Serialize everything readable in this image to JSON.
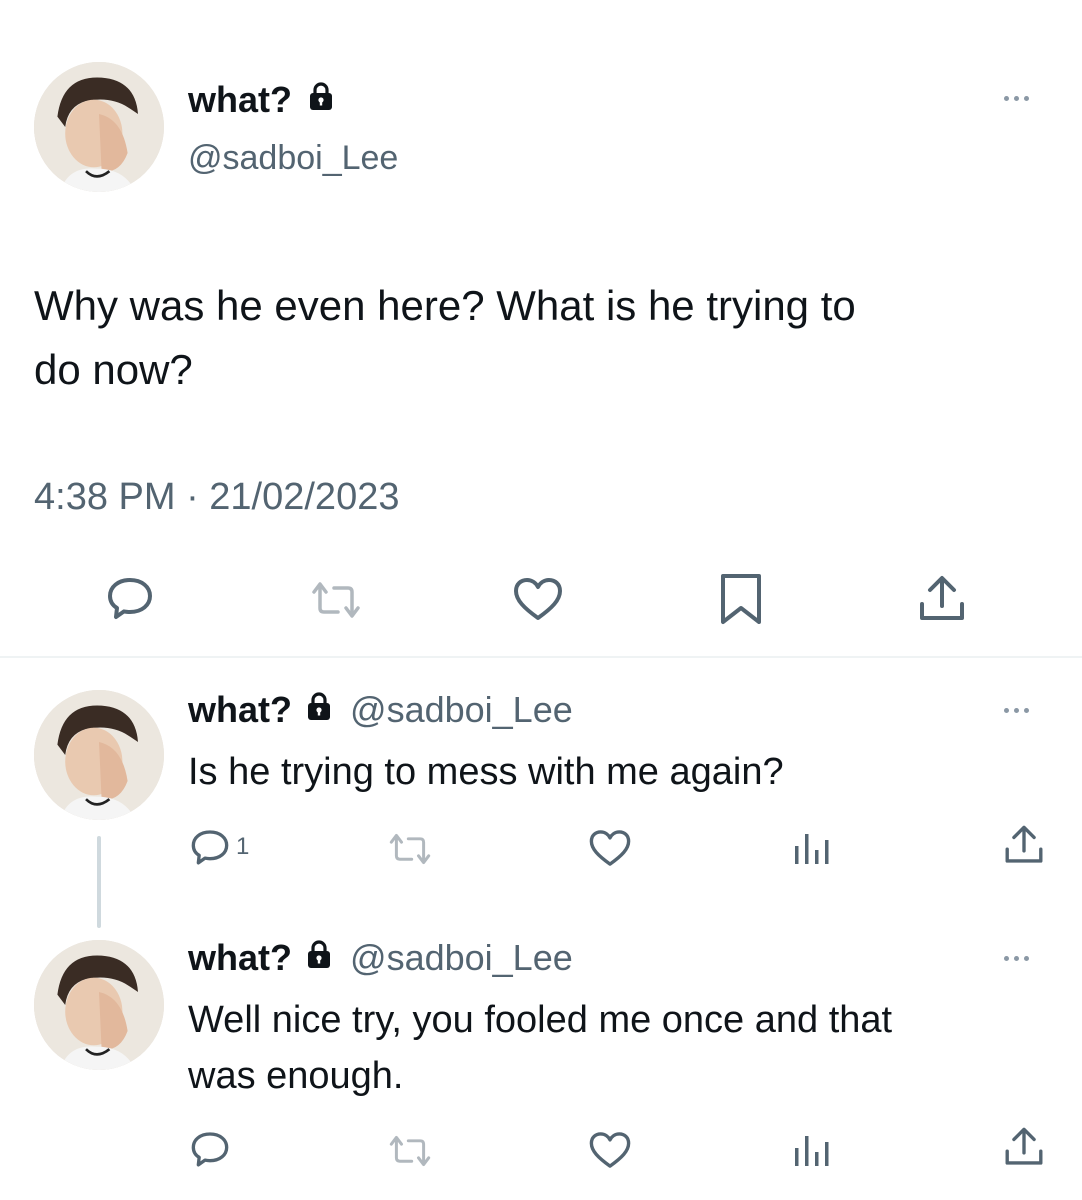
{
  "main_tweet": {
    "display_name": "what?",
    "handle": "@sadboi_Lee",
    "text_line1": "Why was he even here? What is he trying to",
    "text_line2": "do now?",
    "timestamp": "4:38 PM · 21/02/2023"
  },
  "replies": [
    {
      "display_name": "what?",
      "handle": "@sadboi_Lee",
      "text_lines": [
        "Is he trying to mess with me again?"
      ],
      "reply_count": "1"
    },
    {
      "display_name": "what?",
      "handle": "@sadboi_Lee",
      "text_lines": [
        "Well nice try, you fooled me once and that",
        "was enough."
      ],
      "reply_count": ""
    }
  ],
  "colors": {
    "text": "#0f1419",
    "secondary": "#536471",
    "icon": "#536471",
    "divider": "#eff3f4",
    "thread_line": "#cfd9de"
  }
}
